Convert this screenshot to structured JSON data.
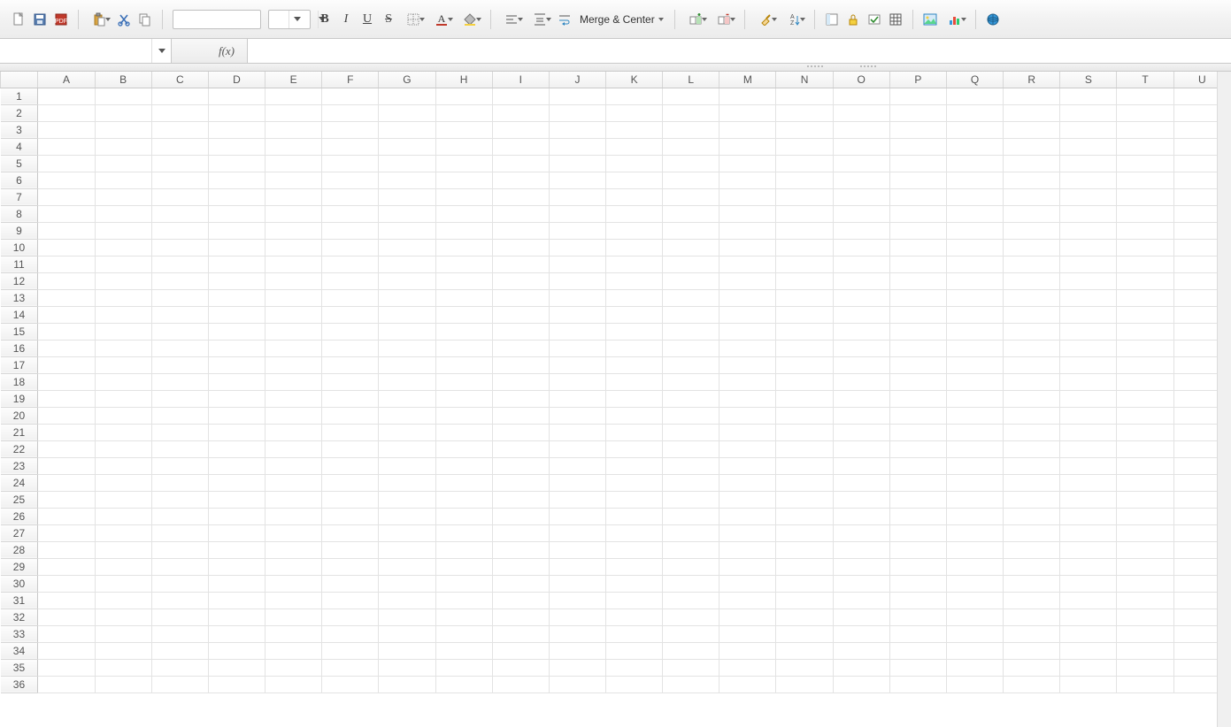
{
  "toolbar": {
    "merge_center_label": "Merge & Center",
    "font_name": "",
    "font_size": ""
  },
  "formula_bar": {
    "name_box_value": "",
    "fx_label": "f(x)",
    "formula_value": ""
  },
  "grid": {
    "columns": [
      "A",
      "B",
      "C",
      "D",
      "E",
      "F",
      "G",
      "H",
      "I",
      "J",
      "K",
      "L",
      "M",
      "N",
      "O",
      "P",
      "Q",
      "R",
      "S",
      "T",
      "U"
    ],
    "row_count": 36,
    "cells": {}
  }
}
